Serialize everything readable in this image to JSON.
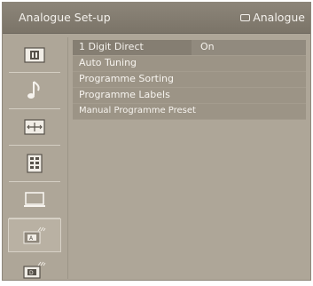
{
  "header": {
    "title": "Analogue Set-up",
    "source_label": "Analogue"
  },
  "sidebar": {
    "items": [
      {
        "icon": "picture-icon",
        "selected": false
      },
      {
        "icon": "music-note-icon",
        "selected": false
      },
      {
        "icon": "screen-icon",
        "selected": false
      },
      {
        "icon": "features-icon",
        "selected": false
      },
      {
        "icon": "pc-monitor-icon",
        "selected": false
      },
      {
        "icon": "analogue-setup-icon",
        "selected": true
      },
      {
        "icon": "digital-setup-icon",
        "selected": false
      }
    ]
  },
  "menu": {
    "items": [
      {
        "label": "1 Digit Direct",
        "value": "On"
      },
      {
        "label": "Auto Tuning"
      },
      {
        "label": "Programme Sorting"
      },
      {
        "label": "Programme Labels"
      },
      {
        "label": "Manual Programme Preset"
      }
    ]
  },
  "colors": {
    "background": "#aea698",
    "titlebar": "#857e72",
    "text": "#f6f3ee"
  }
}
